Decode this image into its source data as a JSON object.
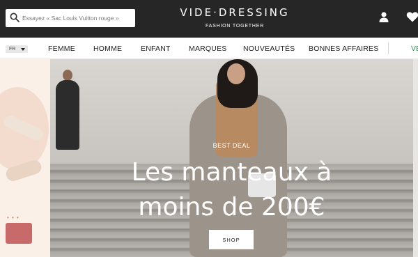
{
  "header": {
    "search": {
      "placeholder": "Essayez « Sac Louis Vuitton rouge »"
    },
    "brand": {
      "logo": "VIDE·DRESSING",
      "tagline": "FASHION TOGETHER"
    },
    "icons": {
      "account": "user-icon",
      "favorites": "heart-icon",
      "search": "search-icon"
    }
  },
  "nav": {
    "language": "FR",
    "items": [
      "FEMME",
      "HOMME",
      "ENFANT",
      "MARQUES",
      "NOUVEAUTÉS",
      "BONNES AFFAIRES"
    ],
    "cut_item": "VE"
  },
  "hero": {
    "kicker": "BEST DEAL",
    "headline": "Les manteaux à moins de 200€",
    "button_label": "SHOP"
  },
  "colors": {
    "header_bg": "#262626",
    "text_dark": "#222222",
    "accent_green": "#3c8a5a"
  }
}
